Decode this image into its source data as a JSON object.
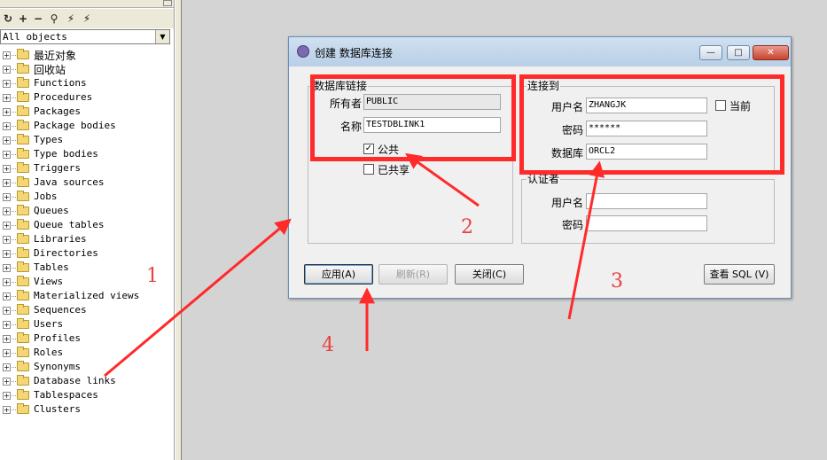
{
  "browser": {
    "filter_value": "All objects",
    "toolbar": [
      "refresh-icon",
      "add-icon",
      "remove-icon",
      "find-icon",
      "filter-icon",
      "filter-clear-icon"
    ],
    "tree": [
      {
        "label": "最近对象",
        "cjk": true
      },
      {
        "label": "回收站",
        "cjk": true
      },
      {
        "label": "Functions"
      },
      {
        "label": "Procedures"
      },
      {
        "label": "Packages"
      },
      {
        "label": "Package bodies"
      },
      {
        "label": "Types"
      },
      {
        "label": "Type bodies"
      },
      {
        "label": "Triggers"
      },
      {
        "label": "Java sources"
      },
      {
        "label": "Jobs"
      },
      {
        "label": "Queues"
      },
      {
        "label": "Queue tables"
      },
      {
        "label": "Libraries"
      },
      {
        "label": "Directories"
      },
      {
        "label": "Tables"
      },
      {
        "label": "Views"
      },
      {
        "label": "Materialized views"
      },
      {
        "label": "Sequences"
      },
      {
        "label": "Users"
      },
      {
        "label": "Profiles"
      },
      {
        "label": "Roles"
      },
      {
        "label": "Synonyms"
      },
      {
        "label": "Database links"
      },
      {
        "label": "Tablespaces"
      },
      {
        "label": "Clusters"
      }
    ]
  },
  "dialog": {
    "title": "创建 数据库连接",
    "window_buttons": {
      "minimize": "—",
      "maximize": "□",
      "close": "✕"
    },
    "dblink_group": {
      "title": "数据库链接",
      "owner_label": "所有者",
      "owner_value": "PUBLIC",
      "name_label": "名称",
      "name_value": "TESTDBLINK1",
      "public_label": "公共",
      "public_checked": true,
      "shared_label": "已共享",
      "shared_checked": false
    },
    "connect_group": {
      "title": "连接到",
      "user_label": "用户名",
      "user_value": "ZHANGJK",
      "current_label": "当前",
      "current_checked": false,
      "password_label": "密码",
      "password_value": "******",
      "database_label": "数据库",
      "database_value": "ORCL2"
    },
    "auth_group": {
      "title": "认证者",
      "user_label": "用户名",
      "user_value": "",
      "password_label": "密码",
      "password_value": ""
    },
    "buttons": {
      "apply": "应用(A)",
      "refresh": "刷新(R)",
      "close": "关闭(C)",
      "view_sql": "查看 SQL (V)"
    }
  },
  "annotations": {
    "numbers": [
      "1",
      "2",
      "3",
      "4"
    ],
    "color": "#ff2a2a"
  }
}
